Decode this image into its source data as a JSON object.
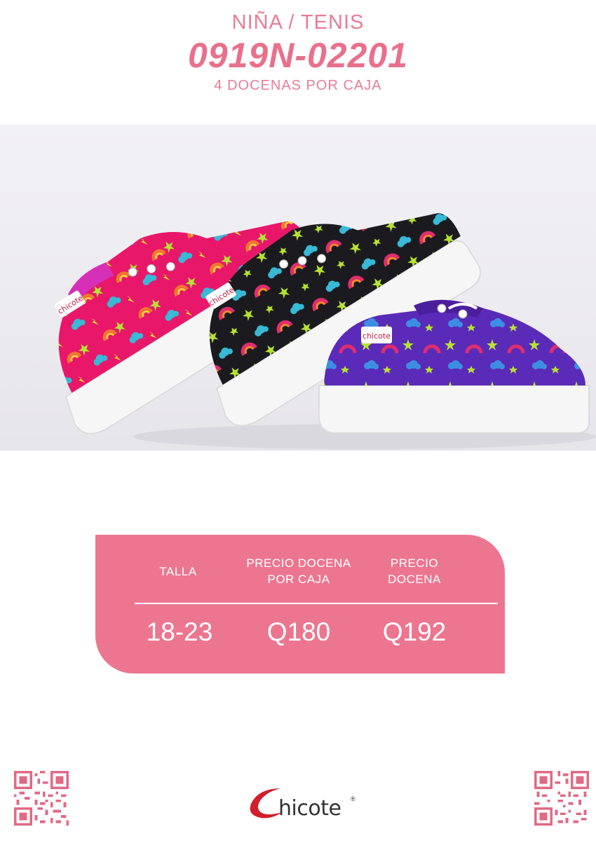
{
  "header": {
    "category": "NIÑA / TENIS",
    "model_code": "0919N-02201",
    "pack_info": "4 DOCENAS POR CAJA"
  },
  "product_image": {
    "description_colors": [
      "#e8176a",
      "#1b1b1f",
      "#5a2bb8"
    ],
    "label_text": "chicote"
  },
  "price_table": {
    "headers": [
      {
        "line1": "TALLA",
        "line2": ""
      },
      {
        "line1": "PRECIO DOCENA",
        "line2": "POR CAJA"
      },
      {
        "line1": "PRECIO",
        "line2": "DOCENA"
      }
    ],
    "values": [
      "18-23",
      "Q180",
      "Q192"
    ],
    "accent_color": "#ec7690"
  },
  "footer": {
    "brand": "hicote",
    "registered": "®"
  }
}
